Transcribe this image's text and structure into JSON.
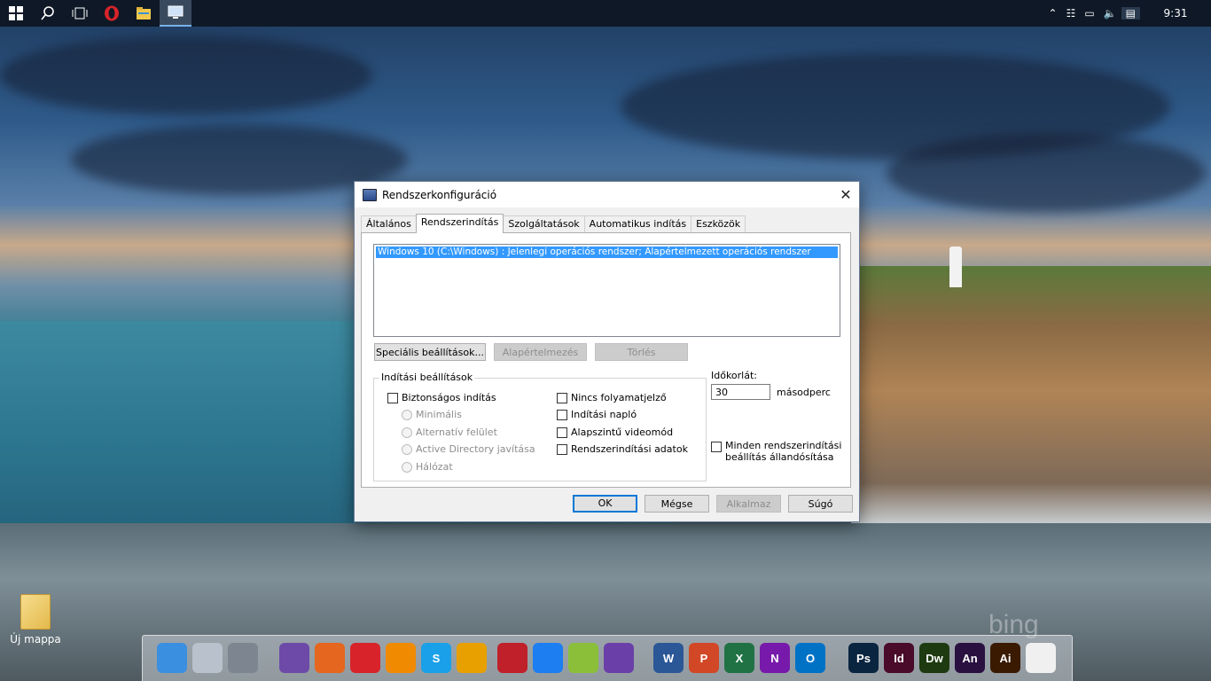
{
  "taskbar": {
    "clock": "9:31",
    "apps": [
      "start-icon",
      "search-icon",
      "task-view-icon",
      "opera-icon",
      "file-explorer-icon",
      "system-config-icon"
    ]
  },
  "desktop": {
    "icon_label": "Új mappa",
    "watermark": "bing"
  },
  "dialog": {
    "title": "Rendszerkonfiguráció",
    "tabs": [
      "Általános",
      "Rendszerindítás",
      "Szolgáltatások",
      "Automatikus indítás",
      "Eszközök"
    ],
    "selected_tab": "Rendszerindítás",
    "os_entries": [
      "Windows 10 (C:\\Windows) : Jelenlegi operációs rendszer; Alapértelmezett operációs rendszer"
    ],
    "buttons": {
      "advanced": "Speciális beállítások...",
      "default": "Alapértelmezés",
      "delete": "Törlés"
    },
    "boot_options": {
      "title": "Indítási beállítások",
      "safe_boot": "Biztonságos indítás",
      "minimal": "Minimális",
      "alternate_shell": "Alternatív felület",
      "ad_repair": "Active Directory javítása",
      "network": "Hálózat",
      "no_gui_boot": "Nincs folyamatjelző",
      "boot_log": "Indítási napló",
      "base_video": "Alapszintű videomód",
      "os_boot_info": "Rendszerindítási adatok"
    },
    "timeout": {
      "label": "Időkorlát:",
      "value": "30",
      "unit": "másodperc"
    },
    "make_permanent": {
      "line1": "Minden rendszerindítási",
      "line2": "beállítás állandósítása"
    },
    "footer": {
      "ok": "OK",
      "cancel": "Mégse",
      "apply": "Alkalmaz",
      "help": "Súgó"
    }
  },
  "dock": {
    "icons": [
      {
        "name": "finder-icon",
        "color": "#3b8fe0",
        "text": ""
      },
      {
        "name": "recycle-bin-icon",
        "color": "#b9c2cc",
        "text": ""
      },
      {
        "name": "settings-icon",
        "color": "#7d8690",
        "text": ""
      },
      {
        "name": "torrent-icon",
        "color": "#6d4aa8",
        "text": ""
      },
      {
        "name": "firefox-icon",
        "color": "#e5661e",
        "text": ""
      },
      {
        "name": "opera-icon",
        "color": "#d8232a",
        "text": ""
      },
      {
        "name": "vlc-icon",
        "color": "#f08a00",
        "text": ""
      },
      {
        "name": "skype-icon",
        "color": "#1aa0e8",
        "text": "S"
      },
      {
        "name": "aimp-icon",
        "color": "#e8a000",
        "text": ""
      },
      {
        "name": "save-disk-icon",
        "color": "#c0202a",
        "text": ""
      },
      {
        "name": "messenger-icon",
        "color": "#1c7ef0",
        "text": ""
      },
      {
        "name": "notepad-plus-icon",
        "color": "#8bbf3a",
        "text": ""
      },
      {
        "name": "visual-studio-icon",
        "color": "#6b3fa8",
        "text": ""
      },
      {
        "name": "word-icon",
        "color": "#2b5797",
        "text": "W"
      },
      {
        "name": "powerpoint-icon",
        "color": "#d24726",
        "text": "P"
      },
      {
        "name": "excel-icon",
        "color": "#207245",
        "text": "X"
      },
      {
        "name": "onenote-icon",
        "color": "#7719aa",
        "text": "N"
      },
      {
        "name": "outlook-icon",
        "color": "#0072c6",
        "text": "O"
      },
      {
        "name": "photoshop-icon",
        "color": "#0a2540",
        "text": "Ps"
      },
      {
        "name": "indesign-icon",
        "color": "#4a0a2a",
        "text": "Id"
      },
      {
        "name": "dreamweaver-icon",
        "color": "#1e3a10",
        "text": "Dw"
      },
      {
        "name": "animate-icon",
        "color": "#2a1040",
        "text": "An"
      },
      {
        "name": "illustrator-icon",
        "color": "#3a1a00",
        "text": "Ai"
      },
      {
        "name": "acrobat-icon",
        "color": "#f0f0f0",
        "text": ""
      }
    ]
  }
}
